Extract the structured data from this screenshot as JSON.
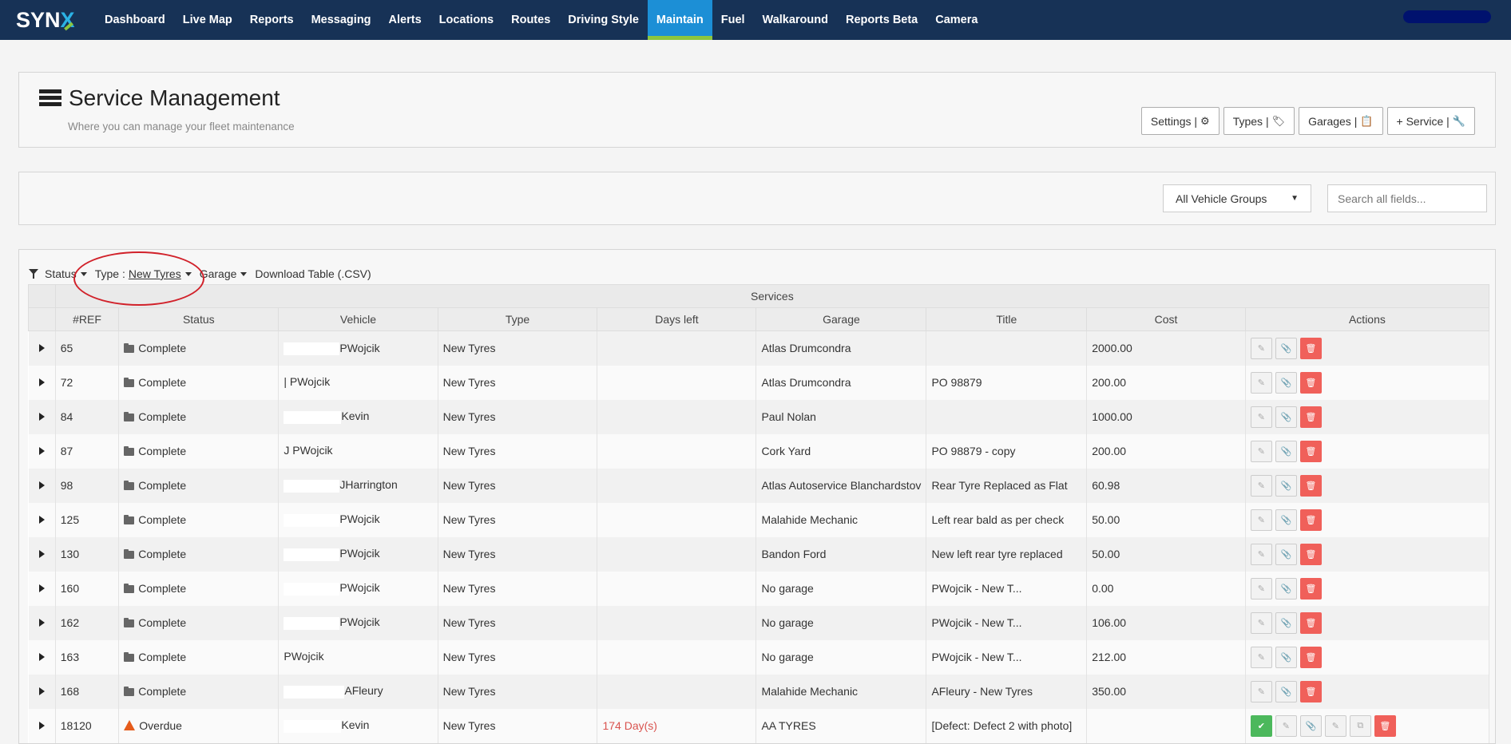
{
  "nav": {
    "logo_main": "SYN",
    "logo_x": "X",
    "items": [
      {
        "label": "Dashboard"
      },
      {
        "label": "Live Map"
      },
      {
        "label": "Reports"
      },
      {
        "label": "Messaging"
      },
      {
        "label": "Alerts"
      },
      {
        "label": "Locations"
      },
      {
        "label": "Routes"
      },
      {
        "label": "Driving Style"
      },
      {
        "label": "Maintain",
        "active": true
      },
      {
        "label": "Fuel"
      },
      {
        "label": "Walkaround"
      },
      {
        "label": "Reports Beta"
      },
      {
        "label": "Camera"
      }
    ]
  },
  "header": {
    "title": "Service Management",
    "subtitle": "Where you can manage your fleet maintenance",
    "buttons": {
      "settings": "Settings |",
      "types": "Types |",
      "garages": "Garages |",
      "add_service": "+ Service |"
    }
  },
  "filters": {
    "group_select": "All Vehicle Groups",
    "search_placeholder": "Search all fields..."
  },
  "table_toolbar": {
    "status": "Status",
    "type_prefix": "Type :",
    "type_value": "New Tyres",
    "garage": "Garage",
    "download": "Download Table (.CSV)"
  },
  "table": {
    "group_header": "Services",
    "columns": [
      "#REF",
      "Status",
      "Vehicle",
      "Type",
      "Days left",
      "Garage",
      "Title",
      "Cost",
      "Actions"
    ],
    "rows": [
      {
        "ref": "65",
        "status": "Complete",
        "vehicle": "PWojcik",
        "type": "New Tyres",
        "days": "",
        "garage": "Atlas Drumcondra",
        "title": "",
        "cost": "2000.00"
      },
      {
        "ref": "72",
        "status": "Complete",
        "vehicle": "| PWojcik",
        "type": "New Tyres",
        "days": "",
        "garage": "Atlas Drumcondra",
        "title": "PO 98879",
        "cost": "200.00"
      },
      {
        "ref": "84",
        "status": "Complete",
        "vehicle": "Kevin",
        "type": "New Tyres",
        "days": "",
        "garage": "Paul Nolan",
        "title": "",
        "cost": "1000.00"
      },
      {
        "ref": "87",
        "status": "Complete",
        "vehicle": "J PWojcik",
        "type": "New Tyres",
        "days": "",
        "garage": "Cork Yard",
        "title": "PO 98879 - copy",
        "cost": "200.00"
      },
      {
        "ref": "98",
        "status": "Complete",
        "vehicle": "JHarrington",
        "type": "New Tyres",
        "days": "",
        "garage": "Atlas Autoservice Blanchardstov",
        "title": "Rear Tyre Replaced as Flat",
        "cost": "60.98"
      },
      {
        "ref": "125",
        "status": "Complete",
        "vehicle": "PWojcik",
        "type": "New Tyres",
        "days": "",
        "garage": "Malahide Mechanic",
        "title": "Left rear bald as per check",
        "cost": "50.00"
      },
      {
        "ref": "130",
        "status": "Complete",
        "vehicle": "PWojcik",
        "type": "New Tyres",
        "days": "",
        "garage": "Bandon Ford",
        "title": "New left rear tyre replaced",
        "cost": "50.00"
      },
      {
        "ref": "160",
        "status": "Complete",
        "vehicle": "PWojcik",
        "type": "New Tyres",
        "days": "",
        "garage": "No garage",
        "title": "PWojcik - New T...",
        "cost": "0.00"
      },
      {
        "ref": "162",
        "status": "Complete",
        "vehicle": "PWojcik",
        "type": "New Tyres",
        "days": "",
        "garage": "No garage",
        "title": "PWojcik - New T...",
        "cost": "106.00"
      },
      {
        "ref": "163",
        "status": "Complete",
        "vehicle": "PWojcik",
        "type": "New Tyres",
        "days": "",
        "garage": "No garage",
        "title": "PWojcik - New T...",
        "cost": "212.00"
      },
      {
        "ref": "168",
        "status": "Complete",
        "vehicle": "AFleury",
        "type": "New Tyres",
        "days": "",
        "garage": "Malahide Mechanic",
        "title": "AFleury - New Tyres",
        "cost": "350.00"
      },
      {
        "ref": "18120",
        "status": "Overdue",
        "vehicle": "Kevin",
        "type": "New Tyres",
        "days": "174 Day(s)",
        "garage": "AA TYRES",
        "title": "[Defect: Defect 2 with photo]",
        "cost": ""
      }
    ]
  },
  "colors": {
    "nav_bg": "#173256",
    "nav_active": "#1c8fd6",
    "active_underline": "#8cc63f",
    "delete_button": "#f0605a",
    "overdue_text": "#d9534f"
  }
}
